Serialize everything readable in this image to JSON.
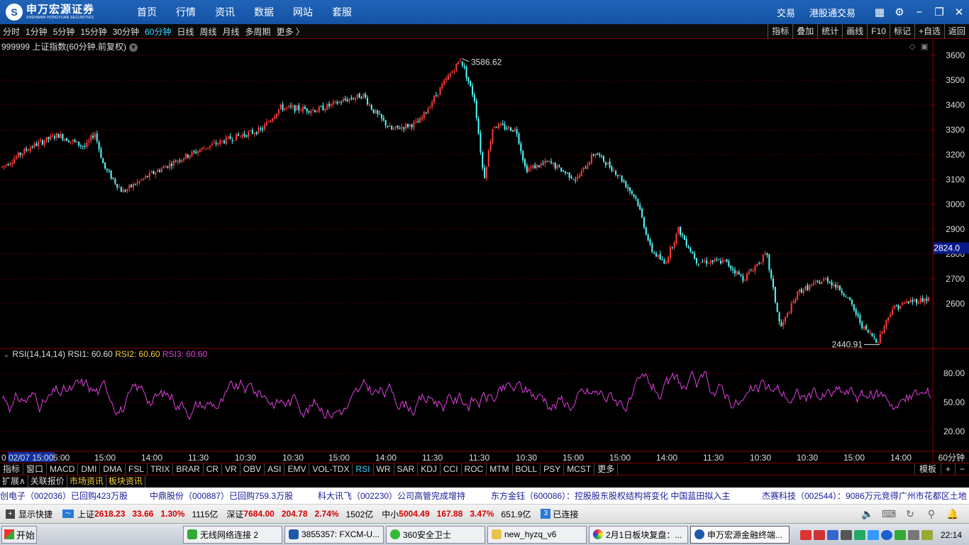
{
  "titlebar": {
    "logo_cn": "申万宏源证券",
    "logo_en": "SHENWAN HONGYUAN SECURITIES",
    "nav": [
      "首页",
      "行情",
      "资讯",
      "数据",
      "网站",
      "套服"
    ],
    "right_links": [
      "交易",
      "港股通交易"
    ],
    "icons": [
      "grid-icon",
      "gear-icon",
      "minimize-icon",
      "restore-icon",
      "close-icon"
    ]
  },
  "periodbar": {
    "periods": [
      "分时",
      "1分钟",
      "5分钟",
      "15分钟",
      "30分钟",
      "60分钟",
      "日线",
      "周线",
      "月线",
      "多周期",
      "更多 〉"
    ],
    "active": "60分钟",
    "tools": [
      "指标",
      "叠加",
      "统计",
      "画线",
      "F10",
      "标记",
      "+自选",
      "返回"
    ]
  },
  "chart": {
    "title": "999999 上证指数(60分钟.前复权)",
    "price_axis": [
      "3600",
      "3500",
      "3400",
      "3300",
      "3200",
      "3100",
      "3000",
      "2900",
      "2800",
      "2700",
      "2600"
    ],
    "current_price_tag": "2824.0",
    "high_label": "3586.62",
    "low_label": "2440.91",
    "up_color": "#ff3c3c",
    "down_color": "#54ffff",
    "grid_color": "#8b0000"
  },
  "rsi": {
    "name": "RSI(14,14,14)",
    "rsi1": "RSI1: 60.60",
    "rsi2": "RSI2: 60.60",
    "rsi3": "RSI3: 60.60",
    "axis": [
      "80.00",
      "50.00",
      "20.00"
    ],
    "line_color": "#e040e0"
  },
  "time_axis": {
    "labels": [
      "0",
      "02/07 15:00",
      "5:00",
      "15:00",
      "14:00",
      "11:30",
      "10:30",
      "10:30",
      "15:00",
      "14:00",
      "11:30",
      "11:30",
      "10:30",
      "15:00",
      "15:00",
      "14:00",
      "11:30",
      "10:30",
      "10:30",
      "15:00",
      "14:00"
    ],
    "unit": "60分钟"
  },
  "indicator_tabs": {
    "items": [
      "指标",
      "窗口",
      "MACD",
      "DMI",
      "DMA",
      "FSL",
      "TRIX",
      "BRAR",
      "CR",
      "VR",
      "OBV",
      "ASI",
      "EMV",
      "VOL-TDX",
      "RSI",
      "WR",
      "SAR",
      "KDJ",
      "CCI",
      "ROC",
      "MTM",
      "BOLL",
      "PSY",
      "MCST",
      "更多"
    ],
    "active": "RSI",
    "right": [
      "模板",
      "+",
      "−"
    ]
  },
  "info_tabs": [
    "扩展∧",
    "关联报价",
    "市场资讯",
    "板块资讯"
  ],
  "ticker": [
    "创电子（002036）已回购423万股",
    "中鼎股份（000887）已回购759.3万股",
    "科大讯飞（002230）公司高管完成增持",
    "东方金钰（600086）：控股股东股权结构将变化  中国蓝田拟入主",
    "杰赛科技（002544）：9086万元竞得广州市花都区土地"
  ],
  "statusbar": {
    "shortcut": "显示快捷",
    "sh_label": "上证",
    "sh_price": "2618.23",
    "sh_change": "33.66",
    "sh_pct": "1.30%",
    "sh_amount": "1115亿",
    "sz_label": "深证",
    "sz_price": "7684.00",
    "sz_change": "204.78",
    "sz_pct": "2.74%",
    "sz_amount": "1502亿",
    "zx_label": "中小",
    "zx_price": "5004.49",
    "zx_change": "167.88",
    "zx_pct": "3.47%",
    "zx_amount": "651.9亿",
    "conn_count": "3",
    "conn_text": "已连接"
  },
  "taskbar": {
    "start": "开始",
    "tasks": [
      "无线网络连接 2",
      "3855357: FXCM-U...",
      "360安全卫士",
      "new_hyzq_v6",
      "2月1日板块复盘：...",
      "申万宏源金融终端..."
    ],
    "clock": "22:14"
  },
  "chart_data": {
    "type": "candlestick",
    "main": {
      "ylim": [
        2420,
        3620
      ],
      "high": 3586.62,
      "low": 2440.91,
      "last": 2618.23,
      "path_points": [
        [
          0,
          3150
        ],
        [
          0.03,
          3230
        ],
        [
          0.06,
          3280
        ],
        [
          0.09,
          3230
        ],
        [
          0.1,
          3290
        ],
        [
          0.11,
          3150
        ],
        [
          0.13,
          3050
        ],
        [
          0.16,
          3120
        ],
        [
          0.19,
          3180
        ],
        [
          0.22,
          3230
        ],
        [
          0.25,
          3270
        ],
        [
          0.28,
          3300
        ],
        [
          0.3,
          3390
        ],
        [
          0.34,
          3380
        ],
        [
          0.37,
          3420
        ],
        [
          0.39,
          3440
        ],
        [
          0.4,
          3380
        ],
        [
          0.42,
          3300
        ],
        [
          0.45,
          3330
        ],
        [
          0.47,
          3450
        ],
        [
          0.495,
          3586
        ],
        [
          0.51,
          3420
        ],
        [
          0.52,
          3100
        ],
        [
          0.53,
          3320
        ],
        [
          0.555,
          3300
        ],
        [
          0.565,
          3140
        ],
        [
          0.59,
          3170
        ],
        [
          0.62,
          3100
        ],
        [
          0.64,
          3210
        ],
        [
          0.665,
          3120
        ],
        [
          0.685,
          3020
        ],
        [
          0.7,
          2820
        ],
        [
          0.715,
          2760
        ],
        [
          0.73,
          2900
        ],
        [
          0.75,
          2770
        ],
        [
          0.78,
          2770
        ],
        [
          0.8,
          2700
        ],
        [
          0.825,
          2800
        ],
        [
          0.84,
          2500
        ],
        [
          0.86,
          2650
        ],
        [
          0.89,
          2700
        ],
        [
          0.91,
          2640
        ],
        [
          0.93,
          2500
        ],
        [
          0.945,
          2450
        ],
        [
          0.96,
          2580
        ],
        [
          0.98,
          2610
        ],
        [
          1,
          2620
        ]
      ]
    },
    "rsi": {
      "ylim": [
        0,
        100
      ],
      "series": [
        {
          "name": "RSI1",
          "last": 60.6
        },
        {
          "name": "RSI2",
          "last": 60.6
        },
        {
          "name": "RSI3",
          "last": 60.6
        }
      ],
      "reference_levels": [
        80,
        50,
        20
      ]
    }
  }
}
